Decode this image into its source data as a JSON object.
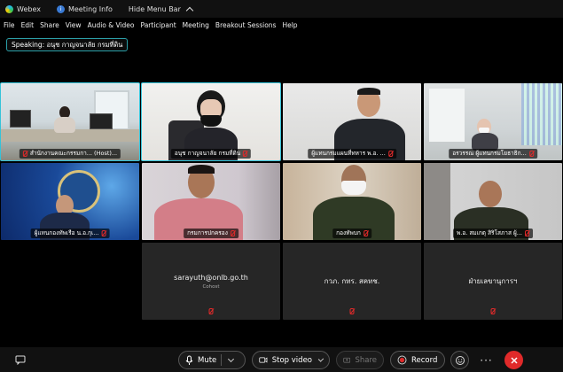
{
  "titlebar": {
    "app_name": "Webex",
    "meeting_info": "Meeting Info",
    "hide_menu": "Hide Menu Bar"
  },
  "menu": [
    "File",
    "Edit",
    "Share",
    "View",
    "Audio & Video",
    "Participant",
    "Meeting",
    "Breakout Sessions",
    "Help"
  ],
  "speaking": "Speaking: อนุช กาญจนาลัย กรมที่ดิน",
  "tiles": [
    {
      "name": "สำนักงานคณะกรรมกา... (Host)..."
    },
    {
      "name": "อนุช กาญจนาลัย กรมที่ดิน"
    },
    {
      "name": "ผู้แทนกรมแผนที่ทหาร พ.อ. ..."
    },
    {
      "name": "อรวรรณ ผู้แทนกรมโยธาธิก..."
    },
    {
      "name": "ผู้แทนกองทัพเรือ น.อ.กุเ..."
    },
    {
      "name": "กรมการปกครอง"
    },
    {
      "name": "กองทัพบก"
    },
    {
      "name": "พ.อ. สมเกตุ สิริโสภาส ผู้..."
    }
  ],
  "audio_tiles": [
    {
      "name": "sarayuth@onlb.go.th",
      "sub": "Cohost"
    },
    {
      "name": "กวภ. กทร. สคทช."
    },
    {
      "name": "ฝ่ายเลขานุการฯ"
    }
  ],
  "toolbar": {
    "mute": "Mute",
    "stop_video": "Stop video",
    "share": "Share",
    "record": "Record"
  },
  "colors": {
    "active_outline": "#35c3d9",
    "leave_red": "#e02a2a",
    "record_red": "#e02a2a"
  }
}
